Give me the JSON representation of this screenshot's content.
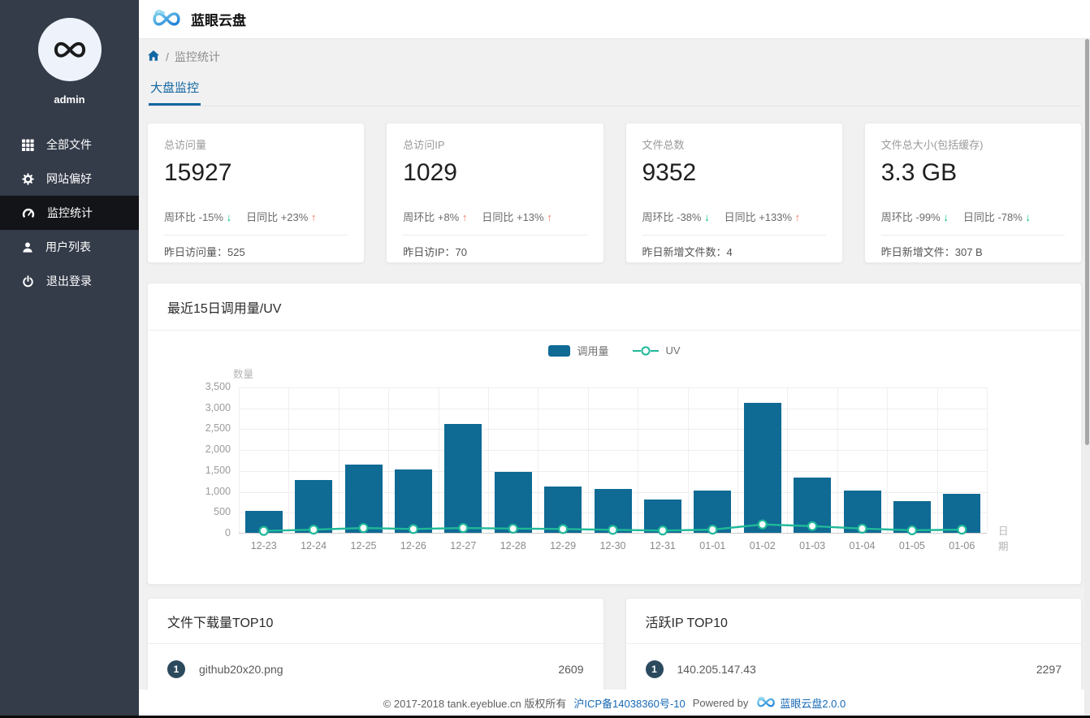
{
  "app": {
    "title": "蓝眼云盘"
  },
  "sidebar": {
    "username": "admin",
    "items": [
      {
        "label": "全部文件",
        "icon": "grid-icon",
        "active": false
      },
      {
        "label": "网站偏好",
        "icon": "gear-icon",
        "active": false
      },
      {
        "label": "监控统计",
        "icon": "gauge-icon",
        "active": true
      },
      {
        "label": "用户列表",
        "icon": "user-icon",
        "active": false
      },
      {
        "label": "退出登录",
        "icon": "power-icon",
        "active": false
      }
    ]
  },
  "breadcrumb": {
    "separator": "/",
    "current": "监控统计"
  },
  "tabs": [
    {
      "label": "大盘监控",
      "active": true
    }
  ],
  "stat_cards": [
    {
      "label": "总访问量",
      "value": "15927",
      "week_label": "周环比",
      "week_value": "-15%",
      "week_dir": "down",
      "day_label": "日同比",
      "day_value": "+23%",
      "day_dir": "up",
      "footer_label": "昨日访问量：",
      "footer_value": "525"
    },
    {
      "label": "总访问IP",
      "value": "1029",
      "week_label": "周环比",
      "week_value": "+8%",
      "week_dir": "up",
      "day_label": "日同比",
      "day_value": "+13%",
      "day_dir": "up",
      "footer_label": "昨日访IP：",
      "footer_value": "70"
    },
    {
      "label": "文件总数",
      "value": "9352",
      "week_label": "周环比",
      "week_value": "-38%",
      "week_dir": "down",
      "day_label": "日同比",
      "day_value": "+133%",
      "day_dir": "up",
      "footer_label": "昨日新增文件数：",
      "footer_value": "4"
    },
    {
      "label": "文件总大小(包括缓存)",
      "value": "3.3 GB",
      "week_label": "周环比",
      "week_value": "-99%",
      "week_dir": "down",
      "day_label": "日同比",
      "day_value": "-78%",
      "day_dir": "down",
      "footer_label": "昨日新增文件：",
      "footer_value": "307 B"
    }
  ],
  "chart_card": {
    "title": "最近15日调用量/UV"
  },
  "chart_data": {
    "type": "bar",
    "title": "最近15日调用量/UV",
    "categories": [
      "12-23",
      "12-24",
      "12-25",
      "12-26",
      "12-27",
      "12-28",
      "12-29",
      "12-30",
      "12-31",
      "01-01",
      "01-02",
      "01-03",
      "01-04",
      "01-05",
      "01-06"
    ],
    "series": [
      {
        "name": "调用量",
        "type": "bar",
        "color": "#0f6a94",
        "values": [
          525,
          1260,
          1630,
          1520,
          2600,
          1450,
          1100,
          1060,
          790,
          1020,
          3110,
          1320,
          1020,
          750,
          930
        ]
      },
      {
        "name": "UV",
        "type": "line",
        "color": "#20b999",
        "values": [
          65,
          95,
          135,
          110,
          135,
          120,
          110,
          90,
          75,
          95,
          220,
          180,
          120,
          80,
          95
        ]
      }
    ],
    "xlabel": "日期",
    "ylabel": "数量",
    "ylim": [
      0,
      3500
    ],
    "ytick_step": 500,
    "grid": true,
    "legend_position": "top-center"
  },
  "top_lists": [
    {
      "title": "文件下载量TOP10",
      "items": [
        {
          "rank": "1",
          "name": "github20x20.png",
          "value": "2609"
        }
      ]
    },
    {
      "title": "活跃IP TOP10",
      "items": [
        {
          "rank": "1",
          "name": "140.205.147.43",
          "value": "2297"
        }
      ]
    }
  ],
  "footer": {
    "copyright": "© 2017-2018 tank.eyeblue.cn 版权所有",
    "icp": "沪ICP备14038360号-10",
    "powered_by": "Powered by",
    "brand": "蓝眼云盘2.0.0"
  },
  "colors": {
    "accent": "#11659f",
    "bar": "#0f6a94",
    "line": "#20b999",
    "up_arrow": "#f5765c",
    "down_arrow": "#00b887",
    "badge": "#2c4a5e",
    "link": "#1769b5"
  }
}
